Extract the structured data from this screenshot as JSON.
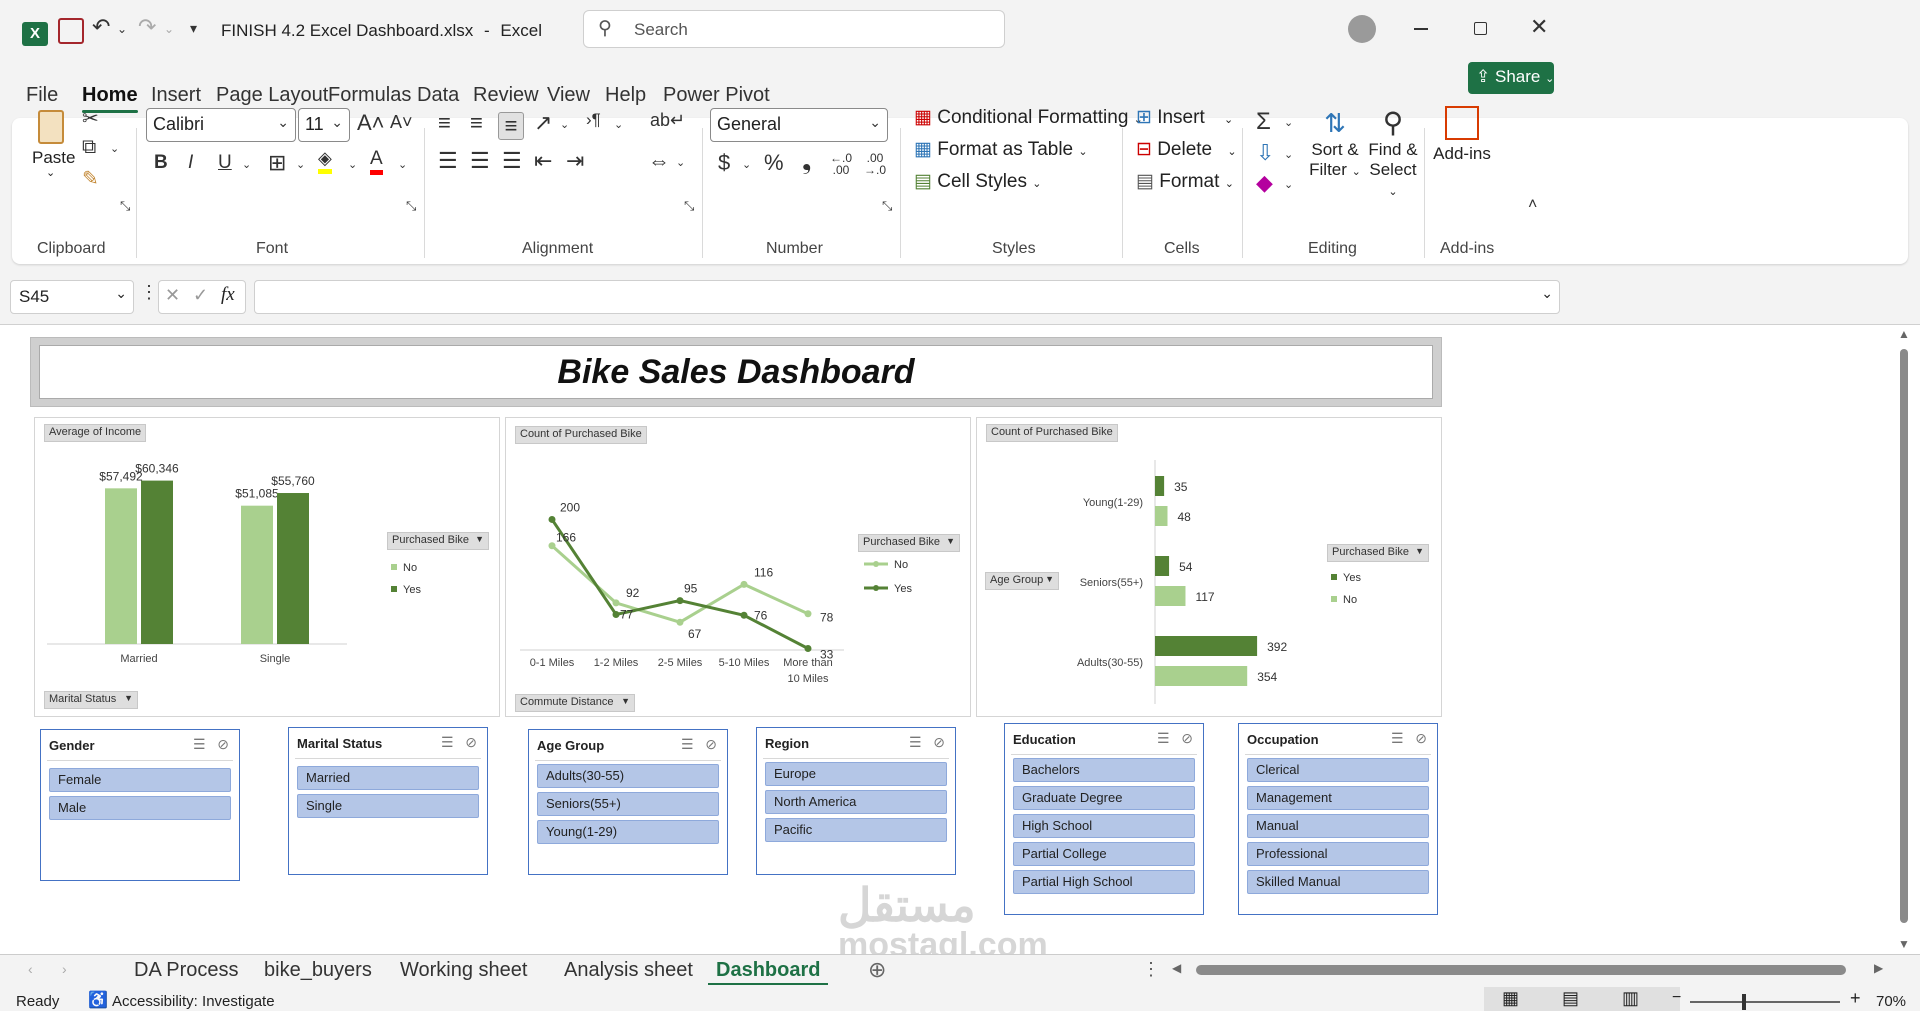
{
  "titlebar": {
    "filename": "FINISH 4.2 Excel Dashboard.xlsx",
    "separator": "-",
    "app": "Excel",
    "search_placeholder": "Search"
  },
  "menu_tabs": [
    "File",
    "Home",
    "Insert",
    "Page Layout",
    "Formulas",
    "Data",
    "Review",
    "View",
    "Help",
    "Power Pivot"
  ],
  "share_label": "Share",
  "ribbon": {
    "clipboard": {
      "paste": "Paste",
      "label": "Clipboard"
    },
    "font": {
      "name": "Calibri",
      "size": "11",
      "label": "Font"
    },
    "alignment": {
      "label": "Alignment"
    },
    "number": {
      "format": "General",
      "label": "Number",
      "dec_inc": ".00",
      "dec_dec": ".0"
    },
    "styles": {
      "conditional": "Conditional Formatting",
      "table": "Format as Table",
      "cell": "Cell Styles",
      "label": "Styles"
    },
    "cells": {
      "insert": "Insert",
      "delete": "Delete",
      "format": "Format",
      "label": "Cells"
    },
    "editing": {
      "sort_l1": "Sort &",
      "sort_l2": "Filter",
      "find_l1": "Find &",
      "find_l2": "Select",
      "label": "Editing"
    },
    "addins": {
      "button": "Add-ins",
      "label": "Add-ins"
    }
  },
  "formula_bar": {
    "name_box": "S45",
    "formula": ""
  },
  "dashboard": {
    "title": "Bike Sales Dashboard",
    "chart1": {
      "value_field": "Average of Income",
      "axis_field": "Marital Status",
      "legend_field": "Purchased Bike"
    },
    "chart2": {
      "value_field": "Count of Purchased Bike",
      "axis_field": "Commute Distance",
      "legend_field": "Purchased Bike"
    },
    "chart3": {
      "value_field": "Count of Purchased Bike",
      "axis_field": "Age Group",
      "legend_field": "Purchased Bike"
    }
  },
  "chart_data": [
    {
      "type": "bar",
      "categories": [
        "Married",
        "Single"
      ],
      "series": [
        {
          "name": "No",
          "values": [
            57492,
            51085
          ],
          "labels": [
            "$57,492",
            "$51,085"
          ],
          "color": "#a9d08e"
        },
        {
          "name": "Yes",
          "values": [
            60346,
            55760
          ],
          "labels": [
            "$60,346",
            "$55,760"
          ],
          "color": "#548235"
        }
      ],
      "legend": [
        "No",
        "Yes"
      ],
      "ylim": [
        0,
        65000
      ],
      "grid": false,
      "legend_position": "right"
    },
    {
      "type": "line",
      "categories": [
        "0-1 Miles",
        "1-2 Miles",
        "2-5 Miles",
        "5-10 Miles",
        "More than 10 Miles"
      ],
      "category_lines": [
        [
          "0-1 Miles"
        ],
        [
          "1-2 Miles"
        ],
        [
          "2-5 Miles"
        ],
        [
          "5-10 Miles"
        ],
        [
          "More than",
          "10 Miles"
        ]
      ],
      "series": [
        {
          "name": "No",
          "values": [
            166,
            92,
            67,
            116,
            78
          ],
          "color": "#a9d08e"
        },
        {
          "name": "Yes",
          "values": [
            200,
            77,
            95,
            76,
            33
          ],
          "color": "#548235"
        }
      ],
      "legend": [
        "No",
        "Yes"
      ],
      "ylim": [
        0,
        220
      ],
      "grid": false,
      "legend_position": "right"
    },
    {
      "type": "bar",
      "orientation": "horizontal",
      "categories": [
        "Adults(30-55)",
        "Seniors(55+)",
        "Young(1-29)"
      ],
      "series": [
        {
          "name": "Yes",
          "values": [
            392,
            54,
            35
          ],
          "color": "#548235"
        },
        {
          "name": "No",
          "values": [
            354,
            117,
            48
          ],
          "color": "#a9d08e"
        }
      ],
      "legend": [
        "Yes",
        "No"
      ],
      "xlim": [
        0,
        430
      ],
      "grid": false,
      "legend_position": "right"
    }
  ],
  "slicers": [
    {
      "title": "Gender",
      "items": [
        "Female",
        "Male"
      ]
    },
    {
      "title": "Marital Status",
      "items": [
        "Married",
        "Single"
      ]
    },
    {
      "title": "Age Group",
      "items": [
        "Adults(30-55)",
        "Seniors(55+)",
        "Young(1-29)"
      ]
    },
    {
      "title": "Region",
      "items": [
        "Europe",
        "North America",
        "Pacific"
      ]
    },
    {
      "title": "Education",
      "items": [
        "Bachelors",
        "Graduate Degree",
        "High School",
        "Partial College",
        "Partial High School"
      ]
    },
    {
      "title": "Occupation",
      "items": [
        "Clerical",
        "Management",
        "Manual",
        "Professional",
        "Skilled Manual"
      ]
    }
  ],
  "sheet_tabs": [
    "DA Process",
    "bike_buyers",
    "Working sheet",
    "Analysis sheet",
    "Dashboard"
  ],
  "status": {
    "ready": "Ready",
    "accessibility": "Accessibility: Investigate",
    "zoom": "70%"
  },
  "watermark": {
    "text": "mostaql.com"
  },
  "colors": {
    "excel_green": "#1e7145",
    "dark_green": "#548235",
    "light_green": "#a9d08e",
    "slicer_blue": "#b4c6e7",
    "slicer_border": "#4472c4"
  }
}
